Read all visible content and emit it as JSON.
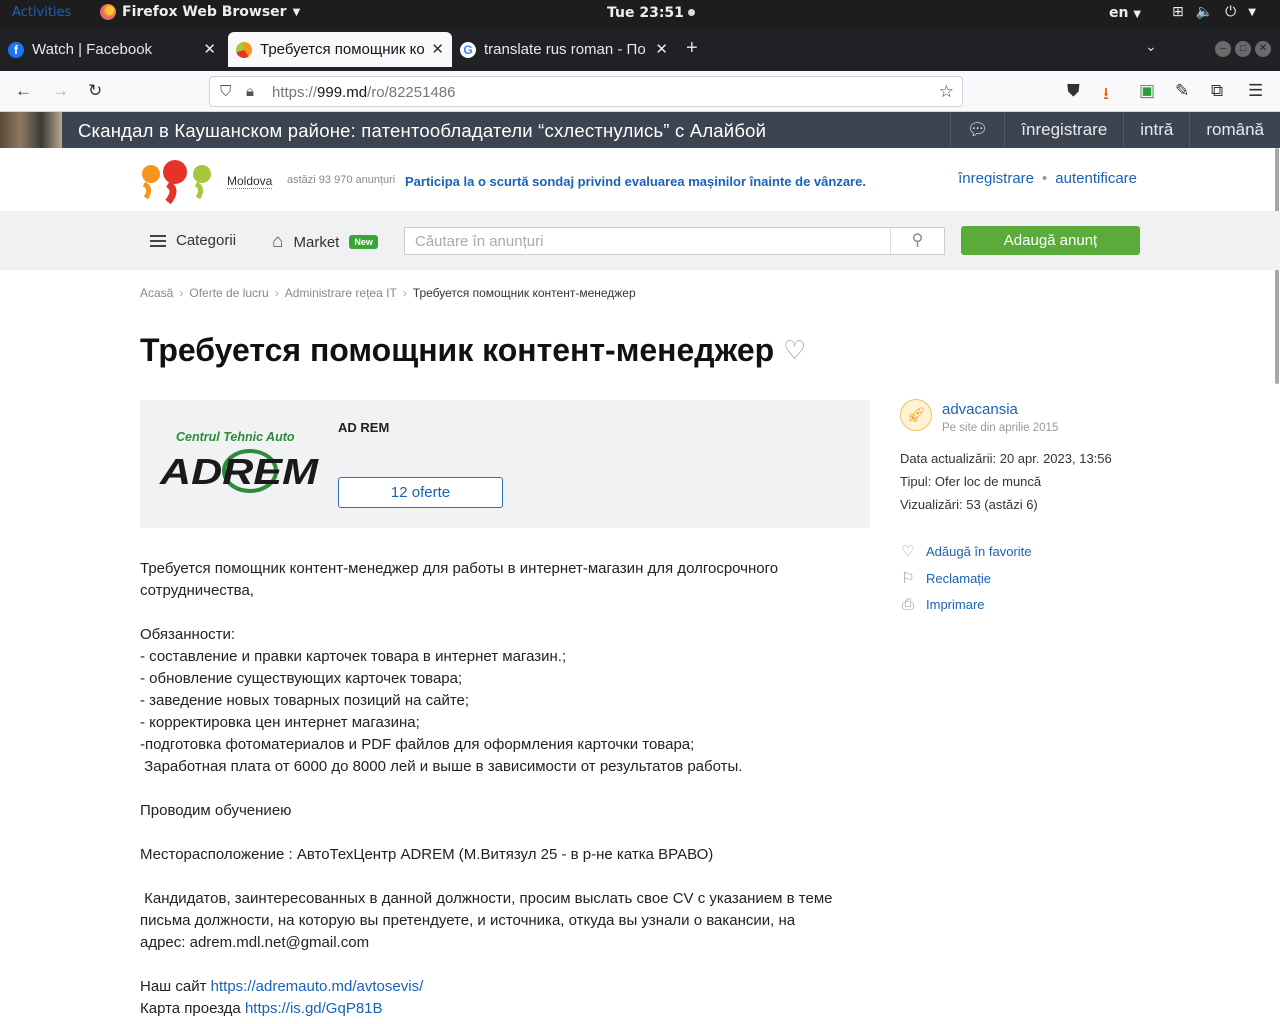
{
  "os": {
    "activities": "Activities",
    "app_name": "Firefox Web Browser",
    "clock": "Tue 23:51",
    "lang": "en"
  },
  "tabs": [
    {
      "title": "Watch | Facebook",
      "favicon": "facebook-icon"
    },
    {
      "title": "Требуется помощник ко",
      "favicon": "999-icon"
    },
    {
      "title": "translate rus roman - По",
      "favicon": "google-icon"
    }
  ],
  "url": {
    "scheme": "https://",
    "host": "999.md",
    "path": "/ro/82251486"
  },
  "banner": {
    "title": "Скандал в Каушанском районе: патентообладатели “схлестнулись” с Алайбой",
    "links": [
      "înregistrare",
      "intră",
      "română"
    ]
  },
  "site": {
    "region": "Moldova",
    "today_ads": "astăzi 93 970 anunțuri",
    "survey": "Participa la o scurtă sondaj privind evaluarea mașinilor înainte de vânzare.",
    "register": "înregistrare",
    "separator": "•",
    "login": "autentificare",
    "categories": "Categorii",
    "market": "Market",
    "new_badge": "New",
    "search_placeholder": "Căutare în anunțuri",
    "add_ad": "Adaugă anunț"
  },
  "breadcrumb": [
    "Acasă",
    "Oferte de lucru",
    "Administrare rețea IT",
    "Требуется помощник контент-менеджер"
  ],
  "ad": {
    "title": "Требуется помощник контент-менеджер",
    "company": {
      "logo_top": "Centrul Tehnic Auto",
      "logo_main": "ADREM",
      "name": "AD REM",
      "offers": "12 oferte"
    },
    "description": [
      "Требуется помощник контент-менеджер для работы в интернет-магазин для долгосрочного сотрудничества,",
      "",
      "Обязанности:",
      "- составление и правки карточек товара в интернет магазин.;",
      "- обновление существующих карточек товара;",
      "- заведение новых товарных позиций на сайте;",
      "- корректировка цен  интернет магазина;",
      "-подготовка фотоматериалов и PDF файлов для оформления карточки товара;",
      " Заработная плата от 6000 до 8000 лей и выше в зависимости от результатов работы.",
      "",
      "Проводим обучениею",
      "",
      "Месторасположение : АвтоТехЦентр ADREM (М.Витязул 25 - в р-не катка ВРАВО)",
      "",
      " Кандидатов, заинтересованных в данной должности, просим выслать свое CV с указанием в теме письма должности, на которую вы претендуете, и источника, откуда вы узнали о вакансии, на адрес: adrem.mdl.net@gmail.com",
      ""
    ],
    "site_label": "Наш сайт ",
    "site_link": "https://adremauto.md/avtosevis/",
    "map_label": "Карта проезда ",
    "map_link": "https://is.gd/GqP81B"
  },
  "seller": {
    "name": "advacansia",
    "since": "Pe site din aprilie 2015",
    "updated": "Data actualizării: 20 apr. 2023, 13:56",
    "type": "Tipul: Ofer loc de muncă",
    "views": "Vizualizări: 53 (astăzi 6)",
    "actions": [
      "Adăugă în favorite",
      "Reclamație",
      "Imprimare"
    ]
  },
  "colors": {
    "accent_blue": "#1a62b8",
    "add_green": "#5aab39",
    "banner_bg": "#3d4451",
    "logo_orange": "#f7941d"
  }
}
